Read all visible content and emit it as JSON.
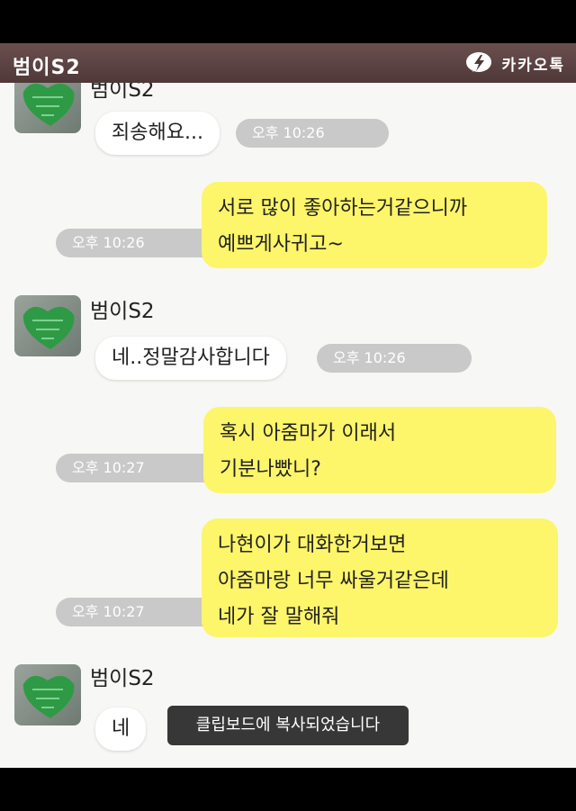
{
  "header": {
    "title": "범이S2",
    "brand_label": "카카오톡"
  },
  "messages": [
    {
      "name": "범이S2",
      "text": "죄송해요...",
      "time": "오후 10:26"
    },
    {
      "lines": [
        "서로 많이 좋아하는거같으니까",
        "예쁘게사귀고~"
      ],
      "time": "오후 10:26"
    },
    {
      "name": "범이S2",
      "text": "네..정말감사합니다",
      "time": "오후 10:26"
    },
    {
      "lines": [
        "혹시 아줌마가 이래서",
        "기분나빴니?"
      ],
      "time": "오후 10:27"
    },
    {
      "lines": [
        "나현이가 대화한거보면",
        "아줌마랑 너무 싸울거같은데",
        "네가 잘 말해줘"
      ],
      "time": "오후 10:27"
    },
    {
      "name": "범이S2",
      "text": "네"
    }
  ],
  "toast": {
    "text": "클립보드에 복사되었습니다"
  }
}
